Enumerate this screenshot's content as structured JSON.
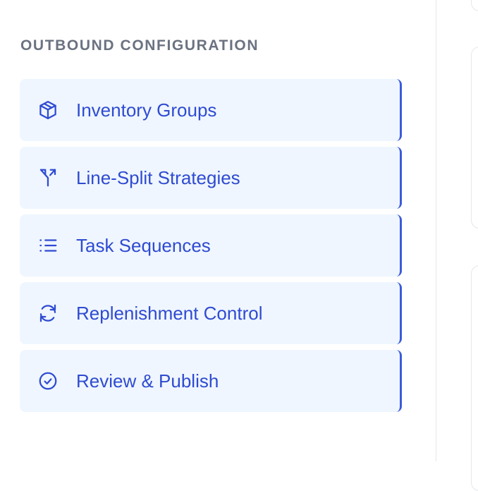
{
  "sidebar": {
    "section_title": "OUTBOUND CONFIGURATION",
    "items": [
      {
        "label": "Inventory Groups",
        "icon": "package-icon"
      },
      {
        "label": "Line-Split Strategies",
        "icon": "split-arrows-icon"
      },
      {
        "label": "Task Sequences",
        "icon": "list-icon"
      },
      {
        "label": "Replenishment Control",
        "icon": "refresh-icon"
      },
      {
        "label": "Review & Publish",
        "icon": "check-circle-icon"
      }
    ]
  },
  "colors": {
    "accent": "#2f4bd1",
    "item_background": "#eff6ff",
    "section_title": "#6b7280",
    "active_border": "#3b5bdb"
  }
}
